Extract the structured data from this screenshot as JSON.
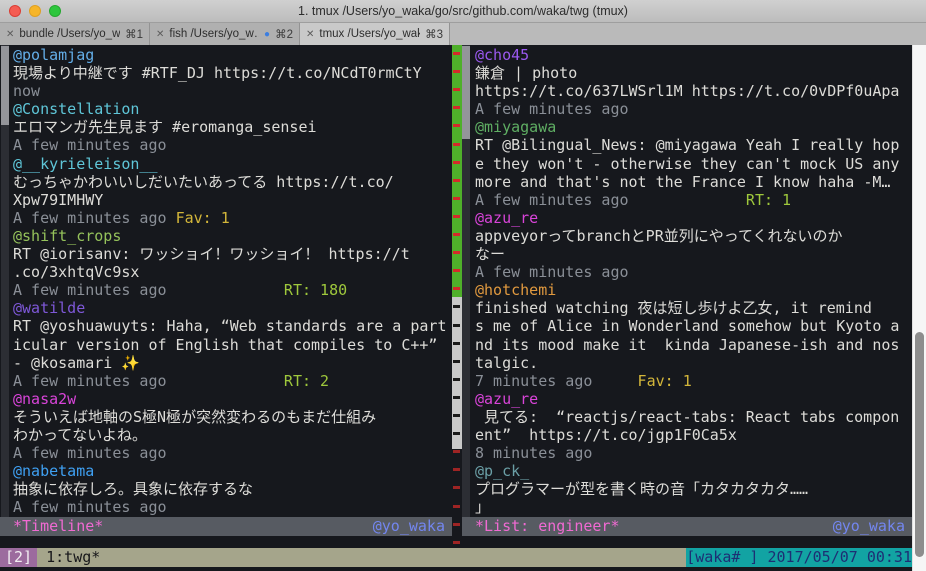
{
  "window": {
    "title": "1. tmux  /Users/yo_waka/go/src/github.com/waka/twg (tmux)"
  },
  "icons": {
    "tab_close": "✕",
    "tab_activity_dot": "●",
    "traffic_lights": [
      "close",
      "minimize",
      "zoom"
    ]
  },
  "tabs": [
    {
      "label": "bundle  /Users/yo_w…",
      "shortcut": "⌘1",
      "active": false,
      "dot": false
    },
    {
      "label": "fish  /Users/yo_w…",
      "shortcut": "⌘2",
      "active": false,
      "dot": true
    },
    {
      "label": "tmux  /Users/yo_wak…",
      "shortcut": "⌘3",
      "active": true,
      "dot": false
    }
  ],
  "left_pane": {
    "rows": [
      [
        {
          "t": "@polamjag",
          "c": "blue"
        }
      ],
      [
        {
          "t": "現場より中継です #RTF_DJ https://t.co/NCdT0rmCtY",
          "c": "white"
        }
      ],
      [
        {
          "t": "now",
          "c": "gray"
        }
      ],
      [
        {
          "t": "@Constellation",
          "c": "cyan"
        }
      ],
      [
        {
          "t": "エロマンガ先生見ます #eromanga_sensei",
          "c": "white"
        }
      ],
      [
        {
          "t": "A few minutes ago",
          "c": "gray"
        }
      ],
      [
        {
          "t": "@__kyrieleison__",
          "c": "cyan"
        }
      ],
      [
        {
          "t": "むっちゃかわいいしだいたいあってる https://t.co/",
          "c": "white"
        }
      ],
      [
        {
          "t": "Xpw79IMHWY",
          "c": "white"
        }
      ],
      [
        {
          "t": "A few minutes ago ",
          "c": "gray"
        },
        {
          "t": "Fav: 1",
          "c": "yellow"
        }
      ],
      [
        {
          "t": "@shift_crops",
          "c": "green"
        }
      ],
      [
        {
          "t": "RT @iorisanv: ワッショイ！ワッショイ！ https://t",
          "c": "white"
        }
      ],
      [
        {
          "t": ".co/3xhtqVc9sx",
          "c": "white"
        }
      ],
      [
        {
          "t": "A few minutes ago",
          "c": "gray"
        },
        {
          "t": "             RT: 180",
          "c": "rtgreen"
        }
      ],
      [
        {
          "t": "@watilde",
          "c": "purple"
        }
      ],
      [
        {
          "t": "RT @yoshuawuyts: Haha, “Web standards are a part",
          "c": "white"
        }
      ],
      [
        {
          "t": "icular version of English that compiles to C++”",
          "c": "white"
        }
      ],
      [
        {
          "t": "- @kosamari ",
          "c": "white"
        },
        {
          "t": "✨",
          "c": "yellow"
        }
      ],
      [
        {
          "t": "A few minutes ago",
          "c": "gray"
        },
        {
          "t": "             RT: 2",
          "c": "rtgreen"
        }
      ],
      [
        {
          "t": "@nasa2w",
          "c": "magenta"
        }
      ],
      [
        {
          "t": "そういえば地軸のS極N極が突然変わるのもまだ仕組み",
          "c": "white"
        }
      ],
      [
        {
          "t": "わかってないよね。",
          "c": "white"
        }
      ],
      [
        {
          "t": "A few minutes ago",
          "c": "gray"
        }
      ],
      [
        {
          "t": "@nabetama",
          "c": "blue2"
        }
      ],
      [
        {
          "t": "抽象に依存しろ。具象に依存するな",
          "c": "white"
        }
      ],
      [
        {
          "t": "A few minutes ago",
          "c": "gray"
        }
      ]
    ],
    "statusbar": {
      "title": "*Timeline*",
      "user": "@yo_waka"
    }
  },
  "right_pane": {
    "rows": [
      [
        {
          "t": "@cho45",
          "c": "violet"
        }
      ],
      [
        {
          "t": "鎌倉 | photo",
          "c": "white"
        }
      ],
      [
        {
          "t": "https://t.co/637LWSrl1M https://t.co/0vDPf0uApa",
          "c": "white"
        }
      ],
      [
        {
          "t": "A few minutes ago",
          "c": "gray"
        }
      ],
      [
        {
          "t": "@miyagawa",
          "c": "dgreen"
        }
      ],
      [
        {
          "t": "RT @Bilingual_News: @miyagawa Yeah I really hop",
          "c": "white"
        }
      ],
      [
        {
          "t": "e they won't - otherwise they can't mock US any",
          "c": "white"
        }
      ],
      [
        {
          "t": "more and that's not the France I know haha -M…",
          "c": "white"
        }
      ],
      [
        {
          "t": "A few minutes ago",
          "c": "gray"
        },
        {
          "t": "             RT: 1",
          "c": "rtgreen"
        }
      ],
      [
        {
          "t": "@azu_re",
          "c": "magenta"
        }
      ],
      [
        {
          "t": "appveyorってbranchとPR並列にやってくれないのか",
          "c": "white"
        }
      ],
      [
        {
          "t": "なー",
          "c": "white"
        }
      ],
      [
        {
          "t": "A few minutes ago",
          "c": "gray"
        }
      ],
      [
        {
          "t": "@hotchemi",
          "c": "orange"
        }
      ],
      [
        {
          "t": "finished watching 夜は短し歩けよ乙女, it remind",
          "c": "white"
        }
      ],
      [
        {
          "t": "s me of Alice in Wonderland somehow but Kyoto a",
          "c": "white"
        }
      ],
      [
        {
          "t": "nd its mood make it  kinda Japanese-ish and nos",
          "c": "white"
        }
      ],
      [
        {
          "t": "talgic.",
          "c": "white"
        }
      ],
      [
        {
          "t": "7 minutes ago",
          "c": "gray"
        },
        {
          "t": "     Fav: 1",
          "c": "yellow"
        }
      ],
      [
        {
          "t": "@azu_re",
          "c": "magenta"
        }
      ],
      [
        {
          "t": " 見てる:  “reactjs/react-tabs: React tabs compon",
          "c": "white"
        }
      ],
      [
        {
          "t": "ent”  https://t.co/jgp1F0Ca5x",
          "c": "white"
        }
      ],
      [
        {
          "t": "8 minutes ago",
          "c": "gray"
        }
      ],
      [
        {
          "t": "@p_ck_",
          "c": "teal"
        }
      ],
      [
        {
          "t": "プログラマーが型を書く時の音「カタカタカタ……",
          "c": "white"
        }
      ],
      [
        {
          "t": "」",
          "c": "white"
        }
      ]
    ],
    "statusbar": {
      "title": "*List: engineer*",
      "user": "@yo_waka"
    }
  },
  "tmux_bar": {
    "session": "[2]",
    "window": " 1:twg*",
    "host": "[waka# ]",
    "datetime": " 2017/05/07 00:31"
  },
  "palette": {
    "terminal_bg": "#16181d",
    "divider_green": "#4fb02a",
    "divider_dash_red": "#d42a2a",
    "status_khaki": "#a5a58b",
    "status_teal": "#12a3a3",
    "session_purple": "#9c6b9e",
    "pane_status_gray": "#575b62",
    "pane_title_pink": "#f06ad2",
    "pane_user_blue": "#7386ef",
    "fav_yellow": "#d3b63a",
    "rt_green": "#9fc83c",
    "timestamp_gray": "#8a8f97"
  }
}
